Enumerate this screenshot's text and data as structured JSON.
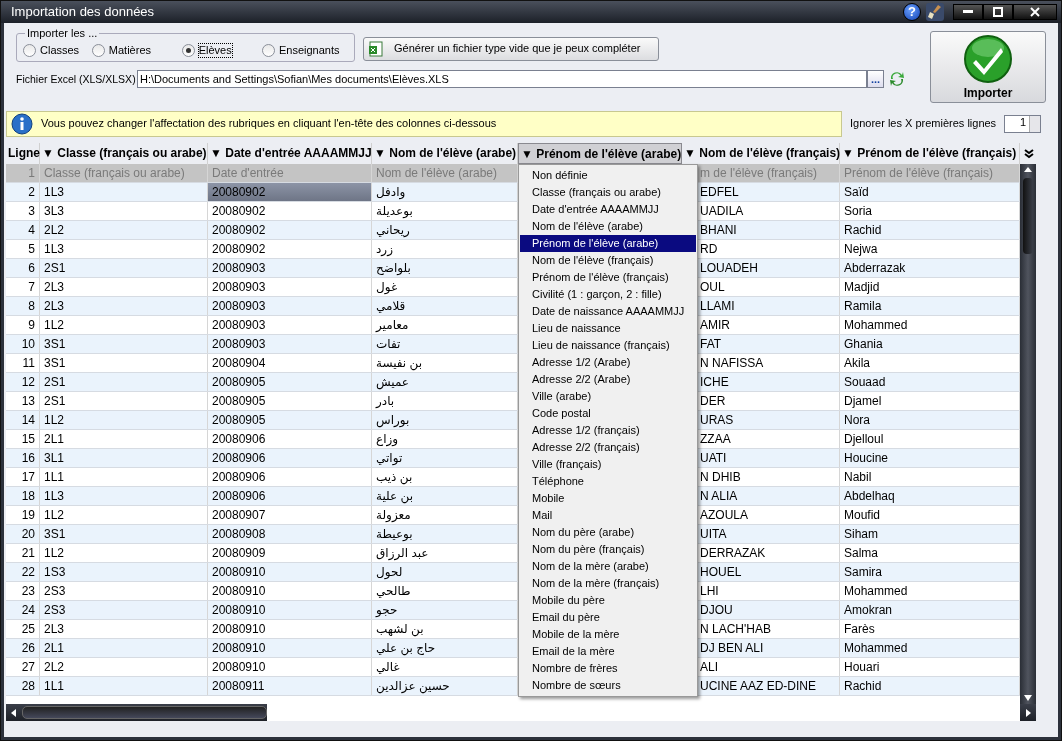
{
  "window": {
    "title": "Importation des données",
    "help_glyph": "?"
  },
  "import_group": {
    "legend": "Importer les ...",
    "options": [
      {
        "label": "Classes",
        "selected": false
      },
      {
        "label": "Matières",
        "selected": false
      },
      {
        "label": "Elèves",
        "selected": true
      },
      {
        "label": "Enseignants",
        "selected": false
      }
    ]
  },
  "generate_button": {
    "label": "Générer un fichier type vide que je peux compléter"
  },
  "file_field": {
    "label": "Fichier Excel (XLS/XLSX)",
    "value": "H:\\Documents and Settings\\Sofian\\Mes documents\\Elèves.XLS"
  },
  "browse_button": {
    "label": "..."
  },
  "import_button": {
    "label": "Importer"
  },
  "info_banner": {
    "text": "Vous pouvez changer l'affectation des rubriques en cliquant l'en-tête des colonnes ci-dessous"
  },
  "skip_lines": {
    "label": "Ignorer les X premières lignes",
    "value": "1"
  },
  "table": {
    "columns": [
      {
        "label": "Ligne",
        "selected": false
      },
      {
        "label": "▼ Classe (français ou arabe)",
        "selected": false
      },
      {
        "label": "▼ Date d'entrée AAAAMMJJ",
        "selected": false
      },
      {
        "label": "▼ Nom de l'élève (arabe)",
        "selected": false
      },
      {
        "label": "▼ Prénom de l'élève (arabe)",
        "selected": true
      },
      {
        "label": "▼ Nom de l'élève (français)",
        "selected": false
      },
      {
        "label": "▼ Prénom de l'élève (français)",
        "selected": false
      }
    ],
    "header_row": {
      "cells": [
        "1",
        "Classe (français ou arabe)",
        "Date d'entrée",
        "Nom de l'élève (arabe)",
        "",
        "m de l'élève (français)",
        "Prénom de l'élève (français)"
      ]
    },
    "rows": [
      {
        "cells": [
          "2",
          {
            "text": "1L3",
            "selected": false
          },
          {
            "text": "20080902",
            "selected": true
          },
          {
            "text": "وادفل",
            "selected": false
          },
          "",
          {
            "text": "EDFEL",
            "selected": false
          },
          {
            "text": "Saïd",
            "selected": false
          }
        ]
      },
      {
        "cells": [
          "3",
          {
            "text": "3L3",
            "selected": false
          },
          {
            "text": "20080902",
            "selected": false
          },
          {
            "text": "بوعديلة",
            "selected": false
          },
          "",
          {
            "text": "UADILA",
            "selected": false
          },
          {
            "text": "Soria",
            "selected": false
          }
        ]
      },
      {
        "cells": [
          "4",
          {
            "text": "2L2",
            "selected": false
          },
          {
            "text": "20080902",
            "selected": false
          },
          {
            "text": "ريحاني",
            "selected": false
          },
          "",
          {
            "text": "BHANI",
            "selected": false
          },
          {
            "text": "Rachid",
            "selected": false
          }
        ]
      },
      {
        "cells": [
          "5",
          {
            "text": "1L3",
            "selected": false
          },
          {
            "text": "20080902",
            "selected": false
          },
          {
            "text": "زرد",
            "selected": false
          },
          "",
          {
            "text": "RD",
            "selected": false
          },
          {
            "text": "Nejwa",
            "selected": false
          }
        ]
      },
      {
        "cells": [
          "6",
          {
            "text": "2S1",
            "selected": false
          },
          {
            "text": "20080903",
            "selected": false
          },
          {
            "text": "بلواضح",
            "selected": false
          },
          "",
          {
            "text": "LOUADEH",
            "selected": false
          },
          {
            "text": "Abderrazak",
            "selected": false
          }
        ]
      },
      {
        "cells": [
          "7",
          {
            "text": "2L3",
            "selected": false
          },
          {
            "text": "20080903",
            "selected": false
          },
          {
            "text": "غول",
            "selected": false
          },
          "",
          {
            "text": "OUL",
            "selected": false
          },
          {
            "text": "Madjid",
            "selected": false
          }
        ]
      },
      {
        "cells": [
          "8",
          {
            "text": "2L3",
            "selected": false
          },
          {
            "text": "20080903",
            "selected": false
          },
          {
            "text": "قلامي",
            "selected": false
          },
          "",
          {
            "text": "LLAMI",
            "selected": false
          },
          {
            "text": "Ramila",
            "selected": false
          }
        ]
      },
      {
        "cells": [
          "9",
          {
            "text": "1L2",
            "selected": false
          },
          {
            "text": "20080903",
            "selected": false
          },
          {
            "text": "معامير",
            "selected": false
          },
          "",
          {
            "text": "AMIR",
            "selected": false
          },
          {
            "text": "Mohammed",
            "selected": false
          }
        ]
      },
      {
        "cells": [
          "10",
          {
            "text": "3S1",
            "selected": false
          },
          {
            "text": "20080903",
            "selected": false
          },
          {
            "text": "تفات",
            "selected": false
          },
          "",
          {
            "text": "FAT",
            "selected": false
          },
          {
            "text": "Ghania",
            "selected": false
          }
        ]
      },
      {
        "cells": [
          "11",
          {
            "text": "3S1",
            "selected": false
          },
          {
            "text": "20080904",
            "selected": false
          },
          {
            "text": "بن نفيسة",
            "selected": false
          },
          "",
          {
            "text": "N NAFISSA",
            "selected": false
          },
          {
            "text": "Akila",
            "selected": false
          }
        ]
      },
      {
        "cells": [
          "12",
          {
            "text": "2S1",
            "selected": false
          },
          {
            "text": "20080905",
            "selected": false
          },
          {
            "text": "عميش",
            "selected": false
          },
          "",
          {
            "text": "ICHE",
            "selected": false
          },
          {
            "text": "Souaad",
            "selected": false
          }
        ]
      },
      {
        "cells": [
          "13",
          {
            "text": "2S1",
            "selected": false
          },
          {
            "text": "20080905",
            "selected": false
          },
          {
            "text": "بادر",
            "selected": false
          },
          "",
          {
            "text": "DER",
            "selected": false
          },
          {
            "text": "Djamel",
            "selected": false
          }
        ]
      },
      {
        "cells": [
          "14",
          {
            "text": "1L2",
            "selected": false
          },
          {
            "text": "20080905",
            "selected": false
          },
          {
            "text": "بوراس",
            "selected": false
          },
          "",
          {
            "text": "URAS",
            "selected": false
          },
          {
            "text": "Nora",
            "selected": false
          }
        ]
      },
      {
        "cells": [
          "15",
          {
            "text": "2L1",
            "selected": false
          },
          {
            "text": "20080906",
            "selected": false
          },
          {
            "text": "وزاع",
            "selected": false
          },
          "",
          {
            "text": "ZZAA",
            "selected": false
          },
          {
            "text": "Djelloul",
            "selected": false
          }
        ]
      },
      {
        "cells": [
          "16",
          {
            "text": "3L1",
            "selected": false
          },
          {
            "text": "20080906",
            "selected": false
          },
          {
            "text": "تواتي",
            "selected": false
          },
          "",
          {
            "text": "UATI",
            "selected": false
          },
          {
            "text": "Houcine",
            "selected": false
          }
        ]
      },
      {
        "cells": [
          "17",
          {
            "text": "1L1",
            "selected": false
          },
          {
            "text": "20080906",
            "selected": false
          },
          {
            "text": "بن ذيب",
            "selected": false
          },
          "",
          {
            "text": "N DHIB",
            "selected": false
          },
          {
            "text": "Nabil",
            "selected": false
          }
        ]
      },
      {
        "cells": [
          "18",
          {
            "text": "1L3",
            "selected": false
          },
          {
            "text": "20080906",
            "selected": false
          },
          {
            "text": "بن علية",
            "selected": false
          },
          "",
          {
            "text": "N ALIA",
            "selected": false
          },
          {
            "text": "Abdelhaq",
            "selected": false
          }
        ]
      },
      {
        "cells": [
          "19",
          {
            "text": "1L2",
            "selected": false
          },
          {
            "text": "20080907",
            "selected": false
          },
          {
            "text": "معزولة",
            "selected": false
          },
          "",
          {
            "text": "AZOULA",
            "selected": false
          },
          {
            "text": "Moufid",
            "selected": false
          }
        ]
      },
      {
        "cells": [
          "20",
          {
            "text": "3S1",
            "selected": false
          },
          {
            "text": "20080908",
            "selected": false
          },
          {
            "text": "بوعيطة",
            "selected": false
          },
          "",
          {
            "text": "UITA",
            "selected": false
          },
          {
            "text": "Siham",
            "selected": false
          }
        ]
      },
      {
        "cells": [
          "21",
          {
            "text": "1L2",
            "selected": false
          },
          {
            "text": "20080909",
            "selected": false
          },
          {
            "text": "عبد الرزاق",
            "selected": false
          },
          "",
          {
            "text": "DERRAZAK",
            "selected": false
          },
          {
            "text": "Salma",
            "selected": false
          }
        ]
      },
      {
        "cells": [
          "22",
          {
            "text": "1S3",
            "selected": false
          },
          {
            "text": "20080910",
            "selected": false
          },
          {
            "text": "لحول",
            "selected": false
          },
          "",
          {
            "text": "HOUEL",
            "selected": false
          },
          {
            "text": "Samira",
            "selected": false
          }
        ]
      },
      {
        "cells": [
          "23",
          {
            "text": "2S3",
            "selected": false
          },
          {
            "text": "20080910",
            "selected": false
          },
          {
            "text": "طالحي",
            "selected": false
          },
          "",
          {
            "text": "LHI",
            "selected": false
          },
          {
            "text": "Mohammed",
            "selected": false
          }
        ]
      },
      {
        "cells": [
          "24",
          {
            "text": "2S3",
            "selected": false
          },
          {
            "text": "20080910",
            "selected": false
          },
          {
            "text": "حجو",
            "selected": false
          },
          "",
          {
            "text": "DJOU",
            "selected": false
          },
          {
            "text": "Amokran",
            "selected": false
          }
        ]
      },
      {
        "cells": [
          "25",
          {
            "text": "2L3",
            "selected": false
          },
          {
            "text": "20080910",
            "selected": false
          },
          {
            "text": "بن لشهب",
            "selected": false
          },
          "",
          {
            "text": "N LACH'HAB",
            "selected": false
          },
          {
            "text": "Farès",
            "selected": false
          }
        ]
      },
      {
        "cells": [
          "26",
          {
            "text": "2L1",
            "selected": false
          },
          {
            "text": "20080910",
            "selected": false
          },
          {
            "text": "حاج بن علي",
            "selected": false
          },
          "",
          {
            "text": "DJ BEN ALI",
            "selected": false
          },
          {
            "text": "Mohammed",
            "selected": false
          }
        ]
      },
      {
        "cells": [
          "27",
          {
            "text": "2L2",
            "selected": false
          },
          {
            "text": "20080910",
            "selected": false
          },
          {
            "text": "غالي",
            "selected": false
          },
          "",
          {
            "text": "ALI",
            "selected": false
          },
          {
            "text": "Houari",
            "selected": false
          }
        ]
      },
      {
        "cells": [
          "28",
          {
            "text": "1L1",
            "selected": false
          },
          {
            "text": "20080911",
            "selected": false
          },
          {
            "text": "حسين عزالدين",
            "selected": false
          },
          "",
          {
            "text": "UCINE AAZ ED-DINE",
            "selected": false
          },
          {
            "text": "Rachid",
            "selected": false
          }
        ]
      }
    ]
  },
  "column_menu": {
    "items": [
      {
        "label": "Non définie",
        "selected": false
      },
      {
        "label": "Classe (français ou arabe)",
        "selected": false
      },
      {
        "label": "Date d'entrée AAAAMMJJ",
        "selected": false
      },
      {
        "label": "Nom de l'élève (arabe)",
        "selected": false
      },
      {
        "label": "Prénom de l'élève (arabe)",
        "selected": true
      },
      {
        "label": "Nom de l'élève (français)",
        "selected": false
      },
      {
        "label": "Prénom de l'élève (français)",
        "selected": false
      },
      {
        "label": "Civilité (1 : garçon, 2 : fille)",
        "selected": false
      },
      {
        "label": "Date de naissance AAAAMMJJ",
        "selected": false
      },
      {
        "label": "Lieu de naissance",
        "selected": false
      },
      {
        "label": "Lieu de naissance (français)",
        "selected": false
      },
      {
        "label": "Adresse 1/2 (Arabe)",
        "selected": false
      },
      {
        "label": "Adresse 2/2 (Arabe)",
        "selected": false
      },
      {
        "label": "Ville (arabe)",
        "selected": false
      },
      {
        "label": "Code postal",
        "selected": false
      },
      {
        "label": "Adresse 1/2 (français)",
        "selected": false
      },
      {
        "label": "Adresse 2/2 (français)",
        "selected": false
      },
      {
        "label": "Ville (français)",
        "selected": false
      },
      {
        "label": "Téléphone",
        "selected": false
      },
      {
        "label": "Mobile",
        "selected": false
      },
      {
        "label": "Mail",
        "selected": false
      },
      {
        "label": "Nom du père (arabe)",
        "selected": false
      },
      {
        "label": "Nom du père (français)",
        "selected": false
      },
      {
        "label": "Nom de la mère (arabe)",
        "selected": false
      },
      {
        "label": "Nom de la mère (français)",
        "selected": false
      },
      {
        "label": "Mobile du père",
        "selected": false
      },
      {
        "label": "Email du père",
        "selected": false
      },
      {
        "label": "Mobile de la mère",
        "selected": false
      },
      {
        "label": "Email de la mère",
        "selected": false
      },
      {
        "label": "Nombre de frères",
        "selected": false
      },
      {
        "label": "Nombre de sœurs",
        "selected": false
      }
    ]
  }
}
